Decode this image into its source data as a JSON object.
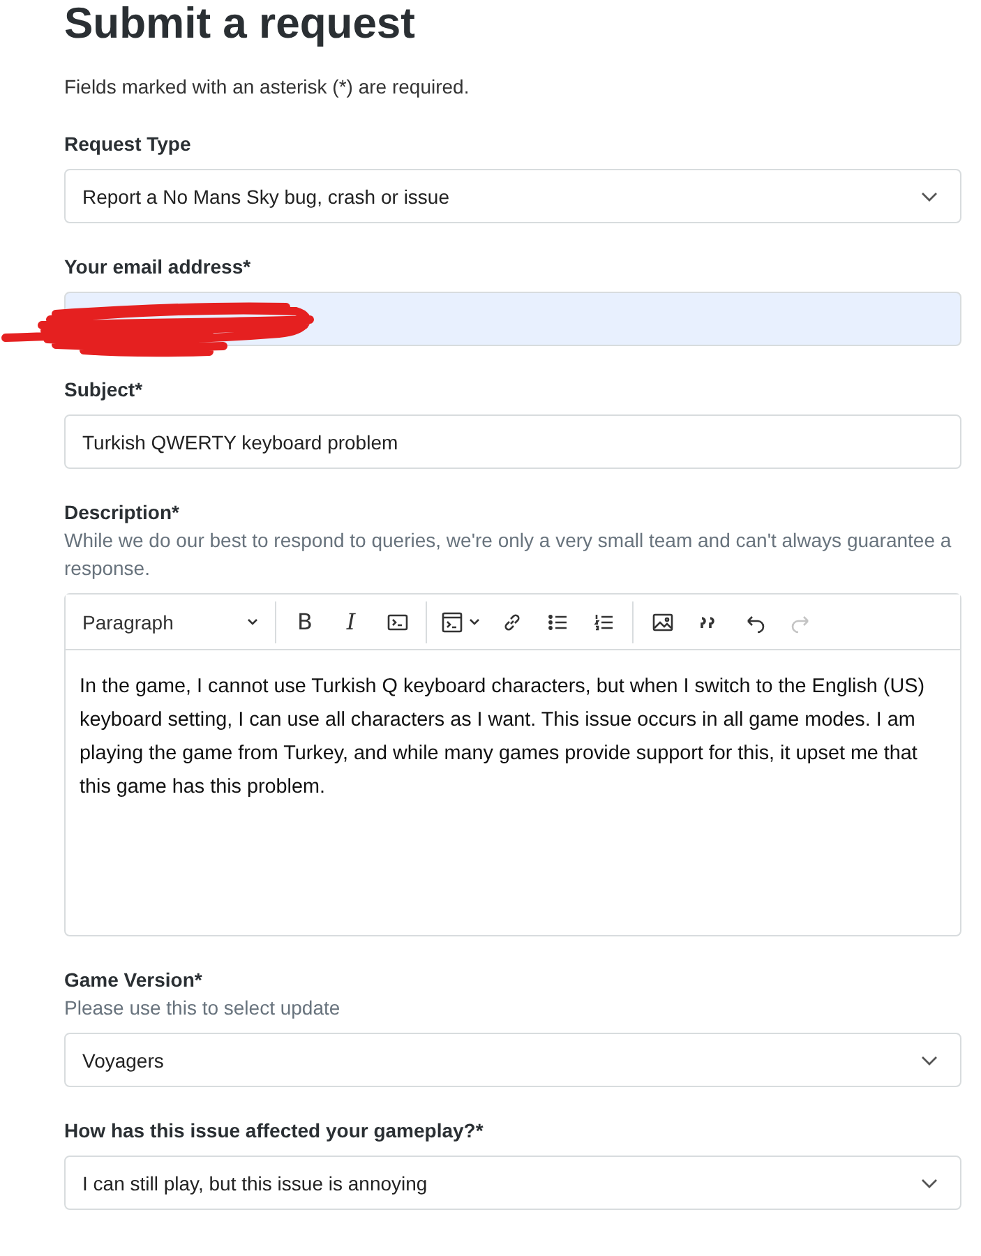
{
  "title": "Submit a request",
  "required_note": "Fields marked with an asterisk (*) are required.",
  "fields": [
    {
      "kind": "select",
      "label": "Request Type",
      "value": "Report a No Mans Sky bug, crash or issue"
    },
    {
      "kind": "redacted",
      "label": "Your email address*",
      "autofilled": true
    },
    {
      "kind": "text",
      "label": "Subject*",
      "value": "Turkish QWERTY keyboard problem"
    },
    {
      "kind": "editor",
      "label": "Description*",
      "hint": "While we do our best to respond to queries, we're only a very small team and can't always guarantee a response.",
      "toolbar": [
        {
          "kind": "dropdown",
          "label": "Paragraph"
        },
        {
          "kind": "divider"
        },
        {
          "kind": "bold",
          "label": "B"
        },
        {
          "kind": "italic",
          "label": "I"
        },
        {
          "kind": "code"
        },
        {
          "kind": "divider"
        },
        {
          "kind": "code-block"
        },
        {
          "kind": "link"
        },
        {
          "kind": "bullets"
        },
        {
          "kind": "numbers"
        },
        {
          "kind": "divider"
        },
        {
          "kind": "image"
        },
        {
          "kind": "quote"
        },
        {
          "kind": "undo",
          "disabled": false
        },
        {
          "kind": "redo",
          "disabled": true
        }
      ],
      "value": "In the game, I cannot use Turkish Q keyboard characters, but when I switch to the English (US) keyboard setting, I can use all characters as I want. This issue occurs in all game modes. I am playing the game from Turkey, and while many games provide support for this, it upset me that this game has this problem."
    },
    {
      "kind": "select",
      "label": "Game Version*",
      "hint": "Please use this to select update",
      "value": "Voyagers"
    },
    {
      "kind": "select",
      "label": "How has this issue affected your gameplay?*",
      "value": "I can still play, but this issue is annoying"
    }
  ]
}
